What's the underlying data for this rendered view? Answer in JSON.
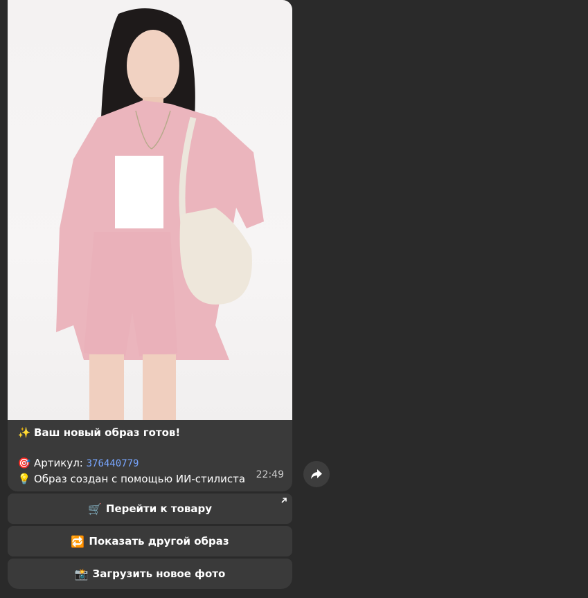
{
  "message": {
    "caption": {
      "title_emoji": "✨",
      "title": "Ваш новый образ готов!",
      "article_emoji": "🎯",
      "article_label": "Артикул: ",
      "article_code": "376440779",
      "note_emoji": "💡",
      "note": "Образ создан с помощью ИИ-стилиста"
    },
    "time": "22:49"
  },
  "buttons": [
    {
      "icon": "🛒",
      "label": "Перейти к товару",
      "external": true
    },
    {
      "icon": "🔁",
      "label": "Показать другой образ"
    },
    {
      "icon": "📸",
      "label": "Загрузить новое фото"
    }
  ],
  "icons": {
    "share": "share-arrow-icon",
    "external": "external-link-arrow-icon"
  },
  "colors": {
    "background": "#2a2a2a",
    "bubble": "#3a3a3a",
    "link_code": "#78a6ff"
  }
}
